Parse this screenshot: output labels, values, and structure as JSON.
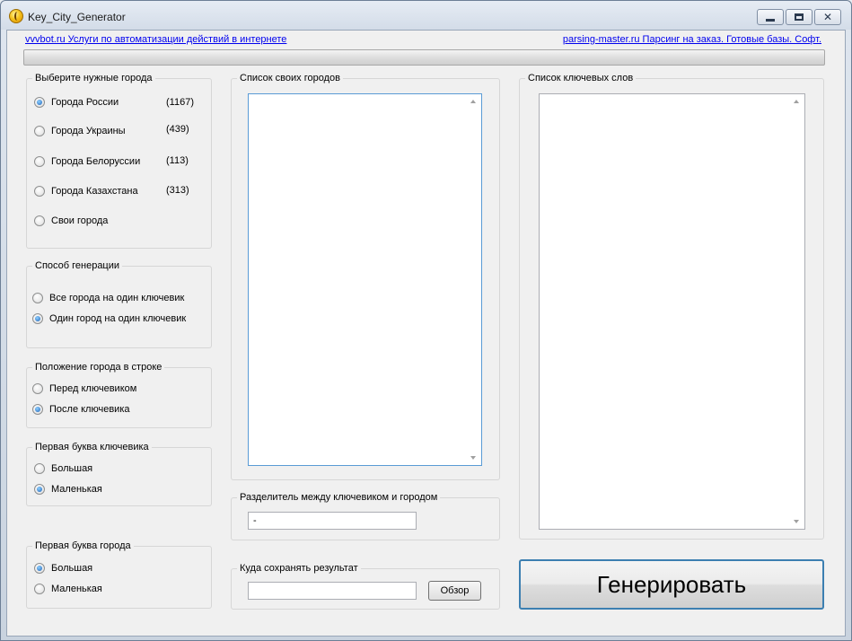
{
  "window": {
    "title": "Key_City_Generator"
  },
  "links": {
    "left": "vvvbot.ru Услуги по автоматизации действий в интернете",
    "right": "parsing-master.ru Парсинг на заказ. Готовые базы. Софт."
  },
  "progress": {
    "value": 0
  },
  "cities_group": {
    "label": "Выберите нужные города",
    "options": [
      {
        "label": "Города России",
        "count": "(1167)",
        "checked": true
      },
      {
        "label": "Города Украины",
        "count": "(439)",
        "checked": false
      },
      {
        "label": "Города Белоруссии",
        "count": "(113)",
        "checked": false
      },
      {
        "label": "Города Казахстана",
        "count": "(313)",
        "checked": false
      },
      {
        "label": "Свои города",
        "count": "",
        "checked": false
      }
    ]
  },
  "generation_group": {
    "label": "Способ генерации",
    "options": [
      {
        "label": "Все города на один ключевик",
        "checked": false
      },
      {
        "label": "Один город на один ключевик",
        "checked": true
      }
    ]
  },
  "position_group": {
    "label": "Положение города в строке",
    "options": [
      {
        "label": "Перед ключевиком",
        "checked": false
      },
      {
        "label": "После ключевика",
        "checked": true
      }
    ]
  },
  "keyword_case_group": {
    "label": "Первая буква ключевика",
    "options": [
      {
        "label": "Большая",
        "checked": false
      },
      {
        "label": "Маленькая",
        "checked": true
      }
    ]
  },
  "city_case_group": {
    "label": "Первая буква города",
    "options": [
      {
        "label": "Большая",
        "checked": true
      },
      {
        "label": "Маленькая",
        "checked": false
      }
    ]
  },
  "own_cities": {
    "label": "Список своих городов",
    "value": ""
  },
  "keywords": {
    "label": "Список ключевых слов",
    "value": ""
  },
  "separator": {
    "label": "Разделитель между ключевиком и городом",
    "value": "-"
  },
  "save": {
    "label": "Куда сохранять результат",
    "value": "",
    "browse_label": "Обзор"
  },
  "generate_label": "Генерировать"
}
